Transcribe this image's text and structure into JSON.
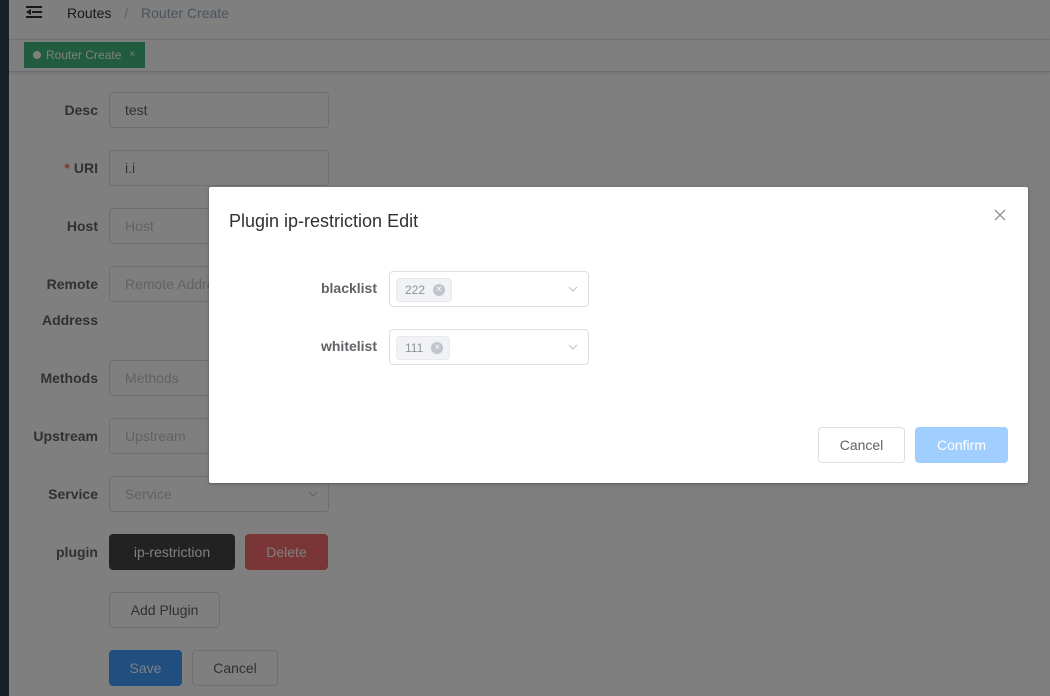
{
  "navbar": {
    "breadcrumb": {
      "home": "Routes",
      "separator": "/",
      "current": "Router Create"
    }
  },
  "tags": {
    "active_label": "Router Create",
    "close_glyph": "×"
  },
  "form": {
    "desc": {
      "label": "Desc",
      "value": "test"
    },
    "uri": {
      "required_mark": "*",
      "label": "URI",
      "value": "i.i"
    },
    "host": {
      "label": "Host",
      "placeholder": "Host"
    },
    "remote_address": {
      "label_line1": "Remote",
      "label_line2": "Address",
      "placeholder": "Remote Address"
    },
    "methods": {
      "label": "Methods",
      "placeholder": "Methods"
    },
    "upstream": {
      "label": "Upstream",
      "placeholder": "Upstream"
    },
    "service": {
      "label": "Service",
      "placeholder": "Service"
    },
    "plugin": {
      "label": "plugin",
      "plugin_button": "ip-restriction",
      "delete_button": "Delete"
    },
    "add_plugin_button": "Add Plugin",
    "save_button": "Save",
    "cancel_button": "Cancel"
  },
  "dialog": {
    "title": "Plugin ip-restriction Edit",
    "blacklist": {
      "label": "blacklist",
      "tags": [
        "222"
      ]
    },
    "whitelist": {
      "label": "whitelist",
      "tags": [
        "111"
      ]
    },
    "cancel_button": "Cancel",
    "confirm_button": "Confirm"
  },
  "colors": {
    "tag_active": "#42b983",
    "danger": "#f56c6c",
    "primary": "#409eff",
    "primary_disabled": "#a0cfff",
    "dark_button": "#454545",
    "sidebar": "#304156"
  },
  "icons": {
    "menu": "hamburger-icon",
    "close": "close-icon",
    "select_arrow": "chevron-down-icon",
    "tag_dot": "dot-icon"
  }
}
